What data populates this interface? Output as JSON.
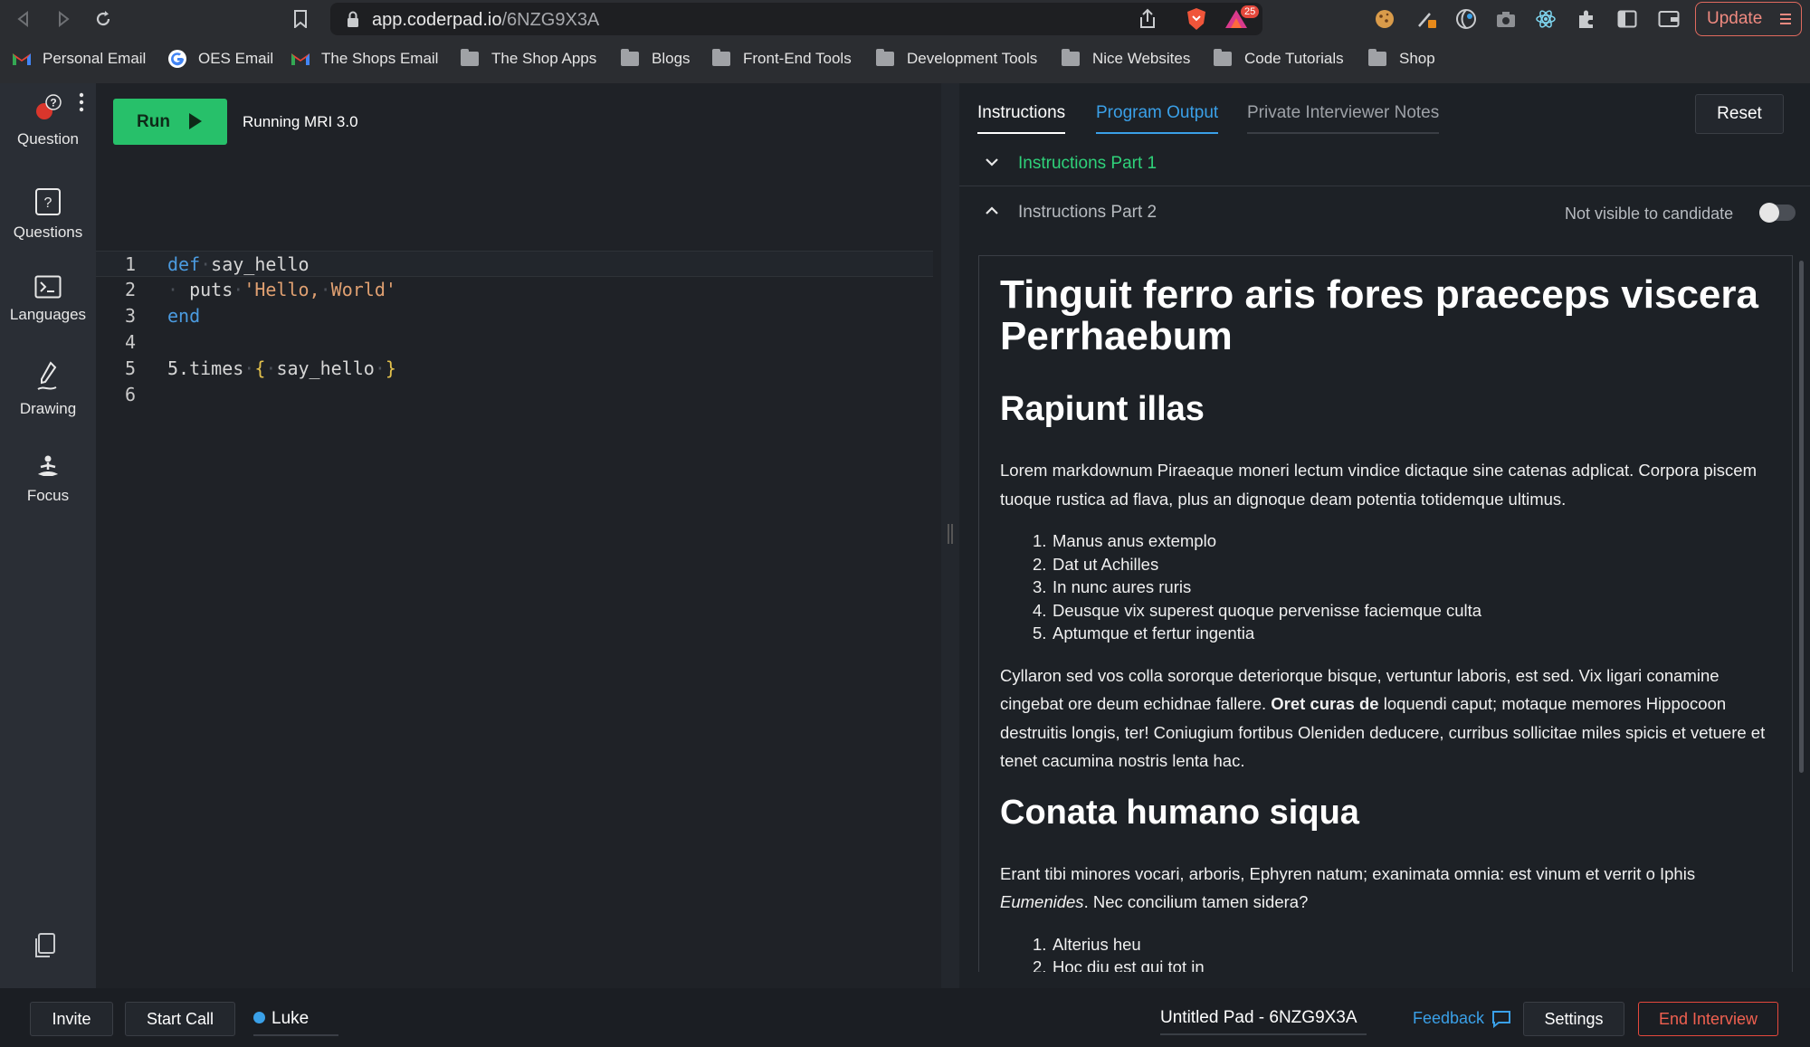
{
  "browser": {
    "url_host": "app.coderpad.io",
    "url_path": "/6NZG9X3A",
    "badge_count": "25",
    "update_label": "Update",
    "bookmarks": [
      {
        "label": "Personal Email",
        "icon": "gmail-icon"
      },
      {
        "label": "OES Email",
        "icon": "google-icon"
      },
      {
        "label": "The Shops Email",
        "icon": "gmail-icon"
      },
      {
        "label": "The Shop Apps",
        "icon": "folder-icon"
      },
      {
        "label": "Blogs",
        "icon": "folder-icon"
      },
      {
        "label": "Front-End Tools",
        "icon": "folder-icon"
      },
      {
        "label": "Development Tools",
        "icon": "folder-icon"
      },
      {
        "label": "Nice Websites",
        "icon": "folder-icon"
      },
      {
        "label": "Code Tutorials",
        "icon": "folder-icon"
      },
      {
        "label": "Shop",
        "icon": "folder-icon"
      }
    ]
  },
  "sidebar": {
    "items": [
      {
        "label": "Question",
        "icon": "question-icon"
      },
      {
        "label": "Questions",
        "icon": "questions-icon"
      },
      {
        "label": "Languages",
        "icon": "terminal-icon"
      },
      {
        "label": "Drawing",
        "icon": "pen-icon"
      },
      {
        "label": "Focus",
        "icon": "meditation-icon"
      }
    ]
  },
  "editor": {
    "run_label": "Run",
    "running_label": "Running MRI 3.0",
    "line_numbers": [
      "1",
      "2",
      "3",
      "4",
      "5",
      "6"
    ]
  },
  "tabs": {
    "instructions": "Instructions",
    "program_output": "Program Output",
    "private_notes": "Private Interviewer Notes",
    "reset_label": "Reset"
  },
  "sections": {
    "part1_title": "Instructions Part 1",
    "part2_title": "Instructions Part 2",
    "visibility_label": "Not visible to candidate"
  },
  "doc": {
    "h1": "Tinguit ferro aris fores praeceps viscera Perrhaebum",
    "h2a": "Rapiunt illas",
    "p1": "Lorem markdownum Piraeaque moneri lectum vindice dictaque sine catenas adplicat. Corpora piscem tuoque rustica ad flava, plus an dignoque deam potentia totidemque ultimus.",
    "list1": [
      "Manus anus extemplo",
      "Dat ut Achilles",
      "In nunc aures ruris",
      "Deusque vix superest quoque pervenisse faciemque culta",
      "Aptumque et fertur ingentia"
    ],
    "p2_a": "Cyllaron sed vos colla sororque deteriorque bisque, vertuntur laboris, est sed. Vix ligari conamine cingebat ore deum echidnae fallere. ",
    "p2_bold": "Oret curas de",
    "p2_b": " loquendi caput; motaque memores Hippocoon destruitis longis, ter! Coniugium fortibus Oleniden deducere, curribus sollicitae miles spicis et vetuere et tenet cacumina nostris lenta hac.",
    "h2b": "Conata humano siqua",
    "p3_a": "Erant tibi minores vocari, arboris, Ephyren natum; exanimata omnia: est vinum et verrit o Iphis ",
    "p3_italic": "Eumenides",
    "p3_b": ". Nec concilium tamen sidera?",
    "list2": [
      "Alterius heu",
      "Hoc diu est qui tot in"
    ]
  },
  "footer": {
    "invite": "Invite",
    "start_call": "Start Call",
    "user": "Luke",
    "pad_name": "Untitled Pad - 6NZG9X3A",
    "feedback": "Feedback",
    "settings": "Settings",
    "end_interview": "End Interview"
  }
}
